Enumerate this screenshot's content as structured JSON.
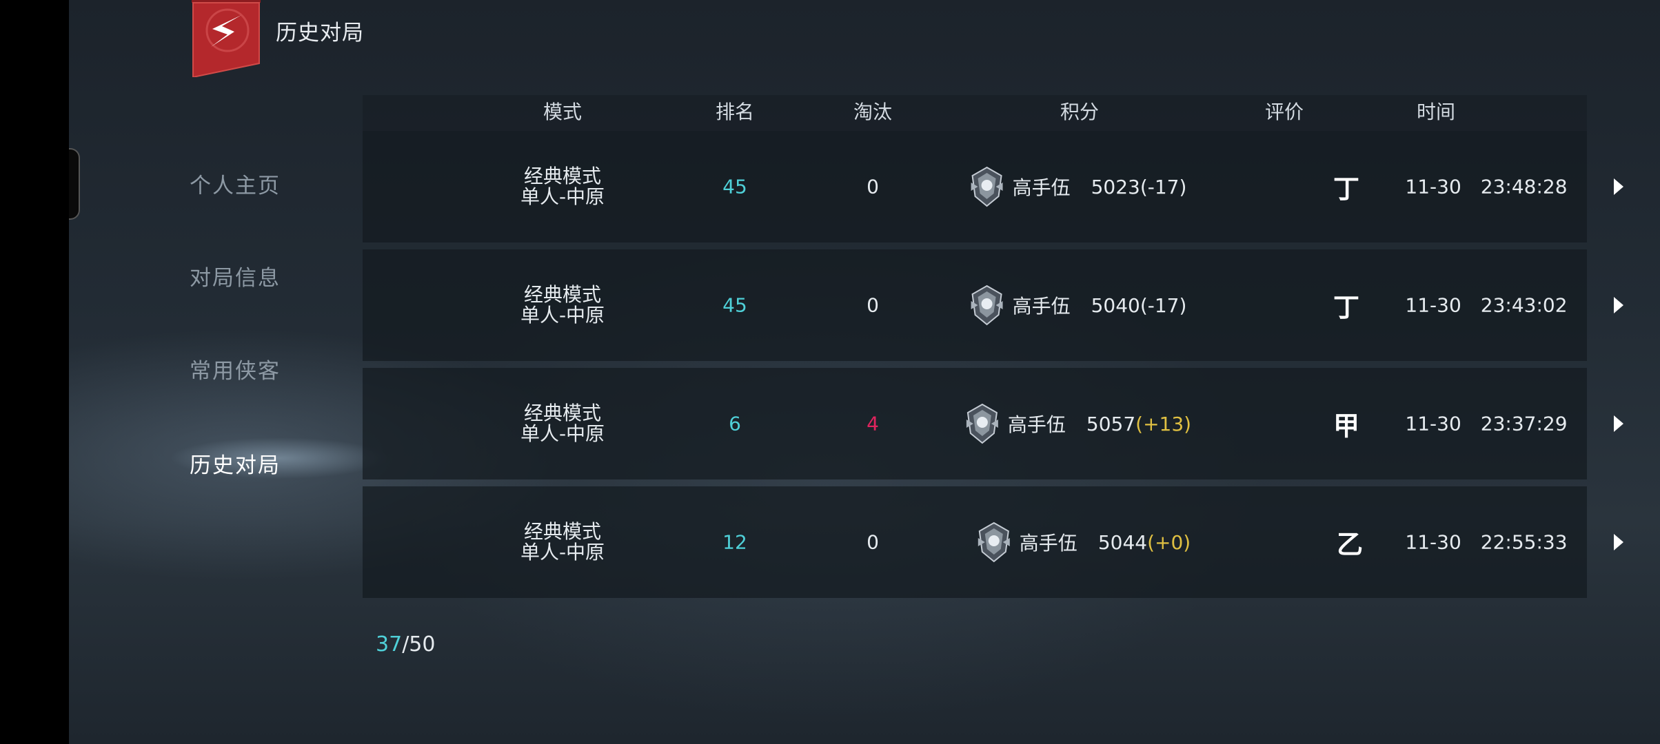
{
  "header": {
    "title": "历史对局"
  },
  "sidebar": {
    "items": [
      {
        "label": "个人主页",
        "active": false
      },
      {
        "label": "对局信息",
        "active": false
      },
      {
        "label": "常用侠客",
        "active": false
      },
      {
        "label": "历史对局",
        "active": true
      }
    ]
  },
  "table": {
    "columns": [
      "模式",
      "排名",
      "淘汰",
      "积分",
      "评价",
      "时间"
    ],
    "rows": [
      {
        "mode_line1": "经典模式",
        "mode_line2": "单人-中原",
        "rank": "45",
        "eliminations": "0",
        "tier": "高手伍",
        "score": "5023",
        "delta": "(-17)",
        "grade": "丁",
        "date": "11-30",
        "time": "23:48:28"
      },
      {
        "mode_line1": "经典模式",
        "mode_line2": "单人-中原",
        "rank": "45",
        "eliminations": "0",
        "tier": "高手伍",
        "score": "5040",
        "delta": "(-17)",
        "grade": "丁",
        "date": "11-30",
        "time": "23:43:02"
      },
      {
        "mode_line1": "经典模式",
        "mode_line2": "单人-中原",
        "rank": "6",
        "eliminations": "4",
        "tier": "高手伍",
        "score": "5057",
        "delta": "(+13)",
        "grade": "甲",
        "date": "11-30",
        "time": "23:37:29"
      },
      {
        "mode_line1": "经典模式",
        "mode_line2": "单人-中原",
        "rank": "12",
        "eliminations": "0",
        "tier": "高手伍",
        "score": "5044",
        "delta": "(+0)",
        "grade": "乙",
        "date": "11-30",
        "time": "22:55:33"
      }
    ]
  },
  "pager": {
    "current": "37",
    "separator": "/",
    "total": "50"
  },
  "colors": {
    "accent_cyan": "#4fd0d8",
    "delta_gold": "#e0c042",
    "elim_red": "#e0245e",
    "logo_red": "#b4282c"
  }
}
